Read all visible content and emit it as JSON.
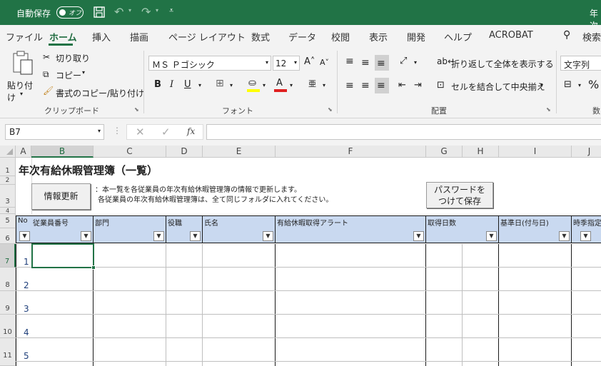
{
  "titlebar": {
    "autosave_label": "自動保存",
    "autosave_state": "オフ",
    "title": "年次"
  },
  "tabs": [
    {
      "label": "ファイル",
      "active": false
    },
    {
      "label": "ホーム",
      "active": true
    },
    {
      "label": "挿入",
      "active": false
    },
    {
      "label": "描画",
      "active": false
    },
    {
      "label": "ページ レイアウト",
      "active": false
    },
    {
      "label": "数式",
      "active": false
    },
    {
      "label": "データ",
      "active": false
    },
    {
      "label": "校閲",
      "active": false
    },
    {
      "label": "表示",
      "active": false
    },
    {
      "label": "開発",
      "active": false
    },
    {
      "label": "ヘルプ",
      "active": false
    },
    {
      "label": "ACROBAT",
      "active": false
    }
  ],
  "search_label": "検索",
  "ribbon": {
    "clipboard": {
      "paste": "貼り付け",
      "cut": "切り取り",
      "copy": "コピー",
      "format_painter": "書式のコピー/貼り付け",
      "group": "クリップボード"
    },
    "font": {
      "name": "ＭＳ Ｐゴシック",
      "size": "12",
      "group": "フォント"
    },
    "alignment": {
      "wrap": "折り返して全体を表示する",
      "merge": "セルを結合して中央揃え",
      "group": "配置"
    },
    "number": {
      "format": "文字列",
      "group": "数"
    }
  },
  "formula_bar": {
    "name_box": "B7",
    "formula": ""
  },
  "columns": [
    "A",
    "B",
    "C",
    "D",
    "E",
    "F",
    "G",
    "H",
    "I",
    "J"
  ],
  "rows": [
    "1",
    "2",
    "3",
    "4",
    "5",
    "6",
    "7",
    "8",
    "9",
    "10",
    "11"
  ],
  "sheet": {
    "title": "年次有給休暇管理簿（一覧）",
    "update_button": "情報更新",
    "note_line1": "：本一覧を各従業員の年次有給休暇管理簿の情報で更新します。",
    "note_line2": "各従業員の年次有給休暇管理簿は、全て同じフォルダに入れてください。",
    "save_button_line1": "パスワードを",
    "save_button_line2": "つけて保存",
    "headers": [
      "No",
      "従業員番号",
      "部門",
      "役職",
      "氏名",
      "有給休暇取得アラート",
      "取得日数",
      "基準日(付与日)",
      "時季指定"
    ],
    "row_numbers": [
      "1",
      "2",
      "3",
      "4",
      "5"
    ]
  }
}
